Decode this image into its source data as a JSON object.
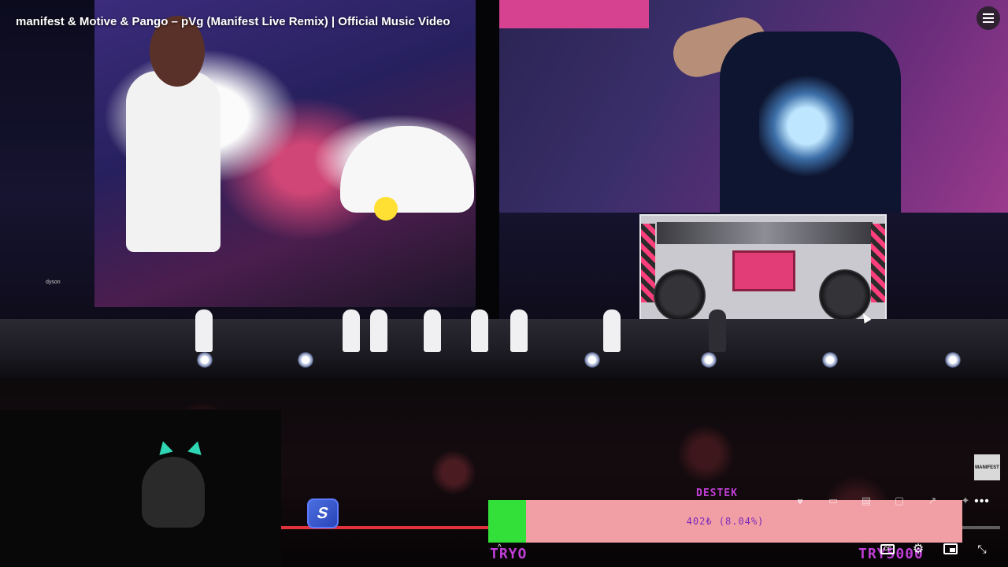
{
  "video": {
    "title": "manifest & Motive & Pango – pVg (Manifest Live Remix) | Official Music Video",
    "venue_logo_text": "dyson",
    "channel_watermark": "MANIFEST"
  },
  "donation": {
    "label": "DESTEK",
    "amount_text": "402₺ (8.04%)",
    "progress_fraction": 0.0804,
    "left_label": "TRYO",
    "right_label": "TRY5000",
    "bar_color": "#f29ea5",
    "fill_color": "#33e03a",
    "text_color": "#c03fd6"
  },
  "player": {
    "playback_progress_fraction": 0.21,
    "progress_color": "#e0323c",
    "icons": {
      "playlist": "playlist-icon",
      "more": "more-horizontal-icon",
      "captions": "captions-icon",
      "settings": "gear-icon",
      "miniplayer": "miniplayer-icon",
      "fullscreen": "fullscreen-exit-icon",
      "app": "streamlabs-icon"
    },
    "captions_label": "CC",
    "more_label": "•••",
    "settings_glyph": "⚙",
    "fullscreen_glyph": "⤡",
    "chevron_glyph": "^"
  }
}
